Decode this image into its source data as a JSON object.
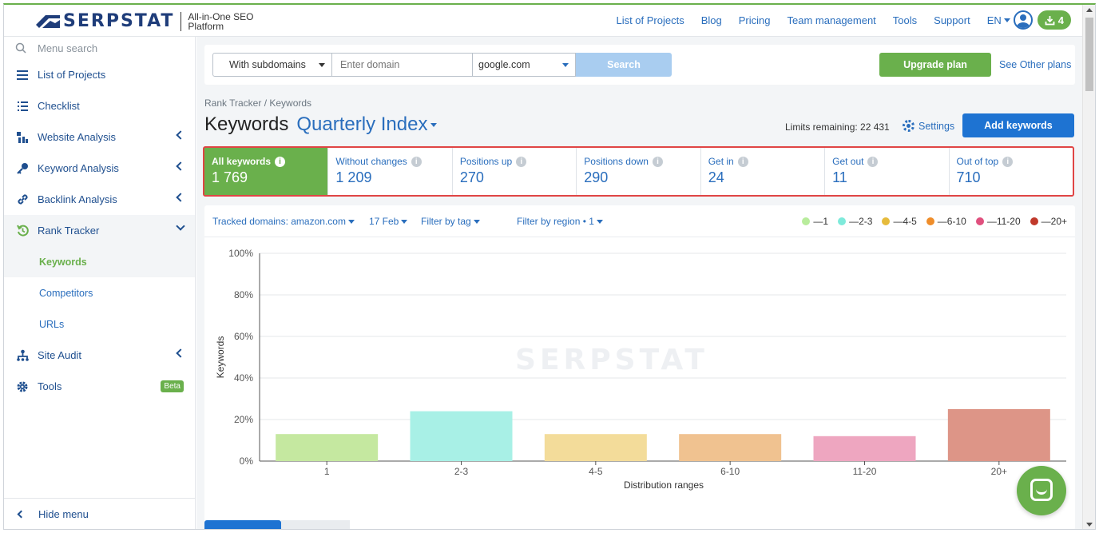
{
  "header": {
    "logo_text": "SERPSTAT",
    "tagline": "All-in-One SEO Platform",
    "nav": [
      "List of Projects",
      "Blog",
      "Pricing",
      "Team management",
      "Tools",
      "Support"
    ],
    "language": "EN",
    "downloads_count": "4"
  },
  "sidebar": {
    "search_placeholder": "Menu search",
    "items": [
      {
        "label": "List of Projects",
        "icon": "list-icon"
      },
      {
        "label": "Checklist",
        "icon": "checklist-icon"
      },
      {
        "label": "Website Analysis",
        "icon": "website-analysis-icon"
      },
      {
        "label": "Keyword Analysis",
        "icon": "key-icon"
      },
      {
        "label": "Backlink Analysis",
        "icon": "link-icon"
      },
      {
        "label": "Rank Tracker",
        "icon": "rank-tracker-icon"
      }
    ],
    "rank_tracker_sub": [
      "Keywords",
      "Competitors",
      "URLs"
    ],
    "site_audit": "Site Audit",
    "tools": "Tools",
    "tools_badge": "Beta",
    "hide_menu": "Hide menu"
  },
  "searchbar": {
    "scope": "With subdomains",
    "domain_placeholder": "Enter domain",
    "search_engine": "google.com",
    "search_label": "Search",
    "upgrade_label": "Upgrade plan",
    "other_plans": "See Other plans"
  },
  "page": {
    "breadcrumb": "Rank Tracker / Keywords",
    "title": "Keywords",
    "project": "Quarterly Index",
    "limits": "Limits remaining: 22 431",
    "settings": "Settings",
    "add_keywords": "Add keywords"
  },
  "stats": [
    {
      "label": "All keywords",
      "value": "1 769"
    },
    {
      "label": "Without changes",
      "value": "1 209"
    },
    {
      "label": "Positions up",
      "value": "270"
    },
    {
      "label": "Positions down",
      "value": "290"
    },
    {
      "label": "Get in",
      "value": "24"
    },
    {
      "label": "Get out",
      "value": "11"
    },
    {
      "label": "Out of top",
      "value": "710"
    }
  ],
  "filters": {
    "tracked": "Tracked domains: amazon.com",
    "date": "17 Feb",
    "tag": "Filter by tag",
    "region": "Filter by region • 1"
  },
  "colors": {
    "brand_green": "#6ab04c",
    "accent_blue": "#2a6ebd",
    "highlight_red": "#e04545"
  },
  "chart_data": {
    "type": "bar",
    "categories": [
      "1",
      "2-3",
      "4-5",
      "6-10",
      "11-20",
      "20+"
    ],
    "series": [
      {
        "values": [
          13,
          24,
          13,
          13,
          12,
          25
        ]
      }
    ],
    "bar_colors": [
      "#c5e8a0",
      "#a8f0e6",
      "#f3dc9a",
      "#f0c290",
      "#eea6c0",
      "#dd9587"
    ],
    "legend": [
      {
        "label": "—1",
        "color": "#b8ec9c"
      },
      {
        "label": "—2-3",
        "color": "#7eeadb"
      },
      {
        "label": "—4-5",
        "color": "#e6bb3c"
      },
      {
        "label": "—6-10",
        "color": "#ef8d2a"
      },
      {
        "label": "—11-20",
        "color": "#e0507e"
      },
      {
        "label": "—20+",
        "color": "#c0392b"
      }
    ],
    "ylabel": "Keywords",
    "xlabel": "Distribution ranges",
    "yticks": [
      "100%",
      "80%",
      "60%",
      "40%",
      "20%",
      "0%"
    ],
    "ylim": [
      0,
      100
    ],
    "grid": true,
    "legend_position": "top-right",
    "watermark": "SERPSTAT"
  }
}
